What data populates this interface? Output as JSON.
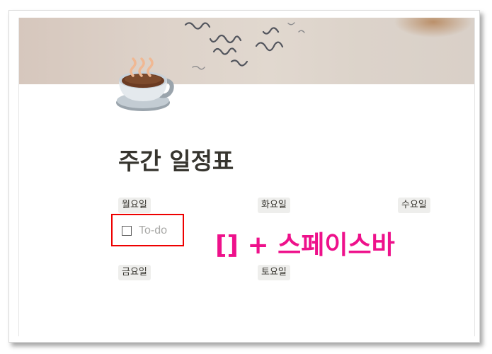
{
  "page": {
    "title": "주간 일정표",
    "icon": "coffee-cup-icon"
  },
  "days": {
    "mon": "월요일",
    "tue": "화요일",
    "wed": "수요일",
    "fri": "금요일",
    "sat": "토요일"
  },
  "todo": {
    "placeholder": "To-do",
    "checked": false
  },
  "annotation": {
    "text": "[] + 스페이스바"
  },
  "colors": {
    "annotation": "#ee118b",
    "highlight_border": "#ee0000",
    "tag_background": "#eeeeec",
    "title_text": "#37352f"
  }
}
